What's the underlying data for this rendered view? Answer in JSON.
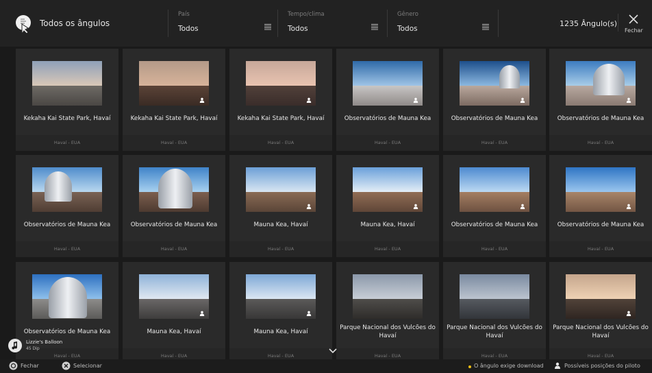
{
  "header": {
    "title": "Todos os ângulos",
    "brand_icon": "pointer-hand-icon",
    "filters": [
      {
        "label": "País",
        "value": "Todos"
      },
      {
        "label": "Tempo/clima",
        "value": "Todos"
      },
      {
        "label": "Gênero",
        "value": "Todos"
      }
    ],
    "count": "1235 Ângulo(s)",
    "close_label": "Fechar"
  },
  "cards": [
    {
      "name": "Kekaha Kai State Park, Havaí",
      "region": "Havaí - EUA",
      "scene": "dusk-flat",
      "pilot": false
    },
    {
      "name": "Kekaha Kai State Park, Havaí",
      "region": "Havaí - EUA",
      "scene": "dusk-brown",
      "pilot": true
    },
    {
      "name": "Kekaha Kai State Park, Havaí",
      "region": "Havaí - EUA",
      "scene": "dusk-pink",
      "pilot": true
    },
    {
      "name": "Observatórios de Mauna Kea",
      "region": "Havaí - EUA",
      "scene": "obs-far",
      "pilot": true
    },
    {
      "name": "Observatórios de Mauna Kea",
      "region": "Havaí - EUA",
      "scene": "obs-dome",
      "pilot": true
    },
    {
      "name": "Observatórios de Mauna Kea",
      "region": "Havaí - EUA",
      "scene": "obs-dome-big",
      "pilot": true
    },
    {
      "name": "Observatórios de Mauna Kea",
      "region": "Havaí - EUA",
      "scene": "obs-dome-side",
      "pilot": false
    },
    {
      "name": "Observatórios de Mauna Kea",
      "region": "Havaí - EUA",
      "scene": "obs-dome-close",
      "pilot": false
    },
    {
      "name": "Mauna Kea, Havaí",
      "region": "Havaí - EUA",
      "scene": "summit",
      "pilot": true
    },
    {
      "name": "Mauna Kea, Havaí",
      "region": "Havaí - EUA",
      "scene": "summit-clouds",
      "pilot": true
    },
    {
      "name": "Observatórios de Mauna Kea",
      "region": "Havaí - EUA",
      "scene": "dishes",
      "pilot": true
    },
    {
      "name": "Observatórios de Mauna Kea",
      "region": "Havaí - EUA",
      "scene": "dishes-row",
      "pilot": true
    },
    {
      "name": "Observatórios de Mauna Kea",
      "region": "Havaí - EUA",
      "scene": "dome-silver",
      "pilot": false
    },
    {
      "name": "Mauna Kea, Havaí",
      "region": "Havaí - EUA",
      "scene": "road",
      "pilot": true
    },
    {
      "name": "Mauna Kea, Havaí",
      "region": "Havaí - EUA",
      "scene": "road-curve",
      "pilot": true
    },
    {
      "name": "Parque Nacional dos Vulcões do Havaí",
      "region": "Havaí - EUA",
      "scene": "lava-road",
      "pilot": false
    },
    {
      "name": "Parque Nacional dos Vulcões do Havaí",
      "region": "Havaí - EUA",
      "scene": "lava-dusk",
      "pilot": false
    },
    {
      "name": "Parque Nacional dos Vulcões do Havaí",
      "region": "Havaí - EUA",
      "scene": "lava-sunset",
      "pilot": true
    }
  ],
  "music": {
    "title": "Lizzie's Balloon",
    "artist": "45 Dip"
  },
  "footer": {
    "close_label": "Fechar",
    "select_label": "Selecionar",
    "download_note": "O ângulo exige download",
    "pilot_note": "Possíveis posições do piloto"
  },
  "colors": {
    "download_dot": "#f2c012"
  }
}
